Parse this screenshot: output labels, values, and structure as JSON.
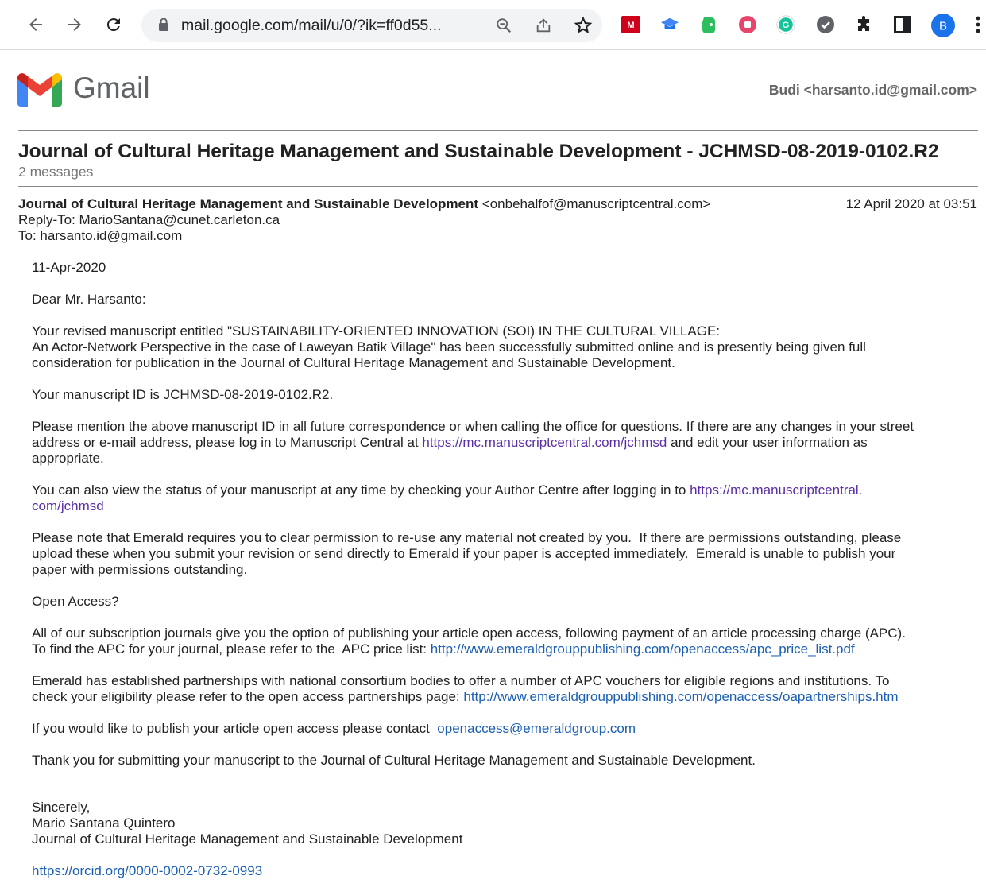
{
  "browser": {
    "url": "mail.google.com/mail/u/0/?ik=ff0d55...",
    "profile_initial": "B",
    "nav_icons": [
      "back-arrow-icon",
      "forward-arrow-icon",
      "reload-icon"
    ],
    "omnibox_icons": [
      "zoom-icon",
      "share-icon",
      "bookmark-star-icon"
    ],
    "extension_icons": [
      "mendeley-icon",
      "mortarboard-icon",
      "evernote-icon",
      "record-icon",
      "grammarly-icon",
      "check-circle-icon",
      "puzzle-icon",
      "side-panel-icon",
      "profile-avatar",
      "more-vert-icon"
    ]
  },
  "gmail": {
    "logo_text": "Gmail",
    "account": "Budi <harsanto.id@gmail.com>"
  },
  "thread": {
    "subject": "Journal of Cultural Heritage Management and Sustainable Development - JCHMSD-08-2019-0102.R2",
    "message_count": "2 messages"
  },
  "message": {
    "from_name": "Journal of Cultural Heritage Management and Sustainable Development",
    "from_email": "<onbehalfof@manuscriptcentral.com>",
    "date": "12 April 2020 at 03:51",
    "reply_to": "Reply-To: MarioSantana@cunet.carleton.ca",
    "to": "To: harsanto.id@gmail.com",
    "body": {
      "date_line": "11-Apr-2020",
      "greeting": "Dear Mr. Harsanto:",
      "p1_line1": "Your revised manuscript entitled \"SUSTAINABILITY-ORIENTED INNOVATION (SOI) IN THE CULTURAL VILLAGE:",
      "p1_line2": "An Actor-Network Perspective in the case of Laweyan Batik Village\" has been successfully submitted online and is presently being given full",
      "p1_line3": "consideration for publication in the Journal of Cultural Heritage Management and Sustainable Development.",
      "p2": "Your manuscript ID is JCHMSD-08-2019-0102.R2.",
      "p3_line1": "Please mention the above manuscript ID in all future correspondence or when calling the office for questions. If there are any changes in your street",
      "p3_line2_pre": "address or e-mail address, please log in to Manuscript Central at ",
      "p3_link": "https://mc.manuscriptcentral.com/jchmsd",
      "p3_line2_post": " and edit your user information as",
      "p3_line3": "appropriate.",
      "p4_pre": "You can also view the status of your manuscript at any time by checking your Author Centre after logging in to ",
      "p4_link_a": "https://mc.manuscriptcentral.",
      "p4_link_b": "com/jchmsd",
      "p5_line1": "Please note that Emerald requires you to clear permission to re-use any material not created by you.  If there are permissions outstanding, please",
      "p5_line2": "upload these when you submit your revision or send directly to Emerald if your paper is accepted immediately.  Emerald is unable to publish your",
      "p5_line3": "paper with permissions outstanding.",
      "p6": "Open Access?",
      "p7_line1": "All of our subscription journals give you the option of publishing your article open access, following payment of an article processing charge (APC).",
      "p7_line2_pre": "To find the APC for your journal, please refer to the  APC price list: ",
      "p7_link": "http://www.emeraldgrouppublishing.com/openaccess/apc_price_list.pdf",
      "p8_line1": "Emerald has established partnerships with national consortium bodies to offer a number of APC vouchers for eligible regions and institutions. To",
      "p8_line2_pre": "check your eligibility please refer to the open access partnerships page: ",
      "p8_link": "http://www.emeraldgrouppublishing.com/openaccess/oapartnerships.htm",
      "p9_pre": "If you would like to publish your article open access please contact  ",
      "p9_link": "openaccess@emeraldgroup.com",
      "p10": "Thank you for submitting your manuscript to the Journal of Cultural Heritage Management and Sustainable Development.",
      "sig1": "Sincerely,",
      "sig2": "Mario Santana Quintero",
      "sig3": "Journal of Cultural Heritage Management and Sustainable Development",
      "orcid_link": "https://orcid.org/0000-0002-0732-0993"
    }
  }
}
